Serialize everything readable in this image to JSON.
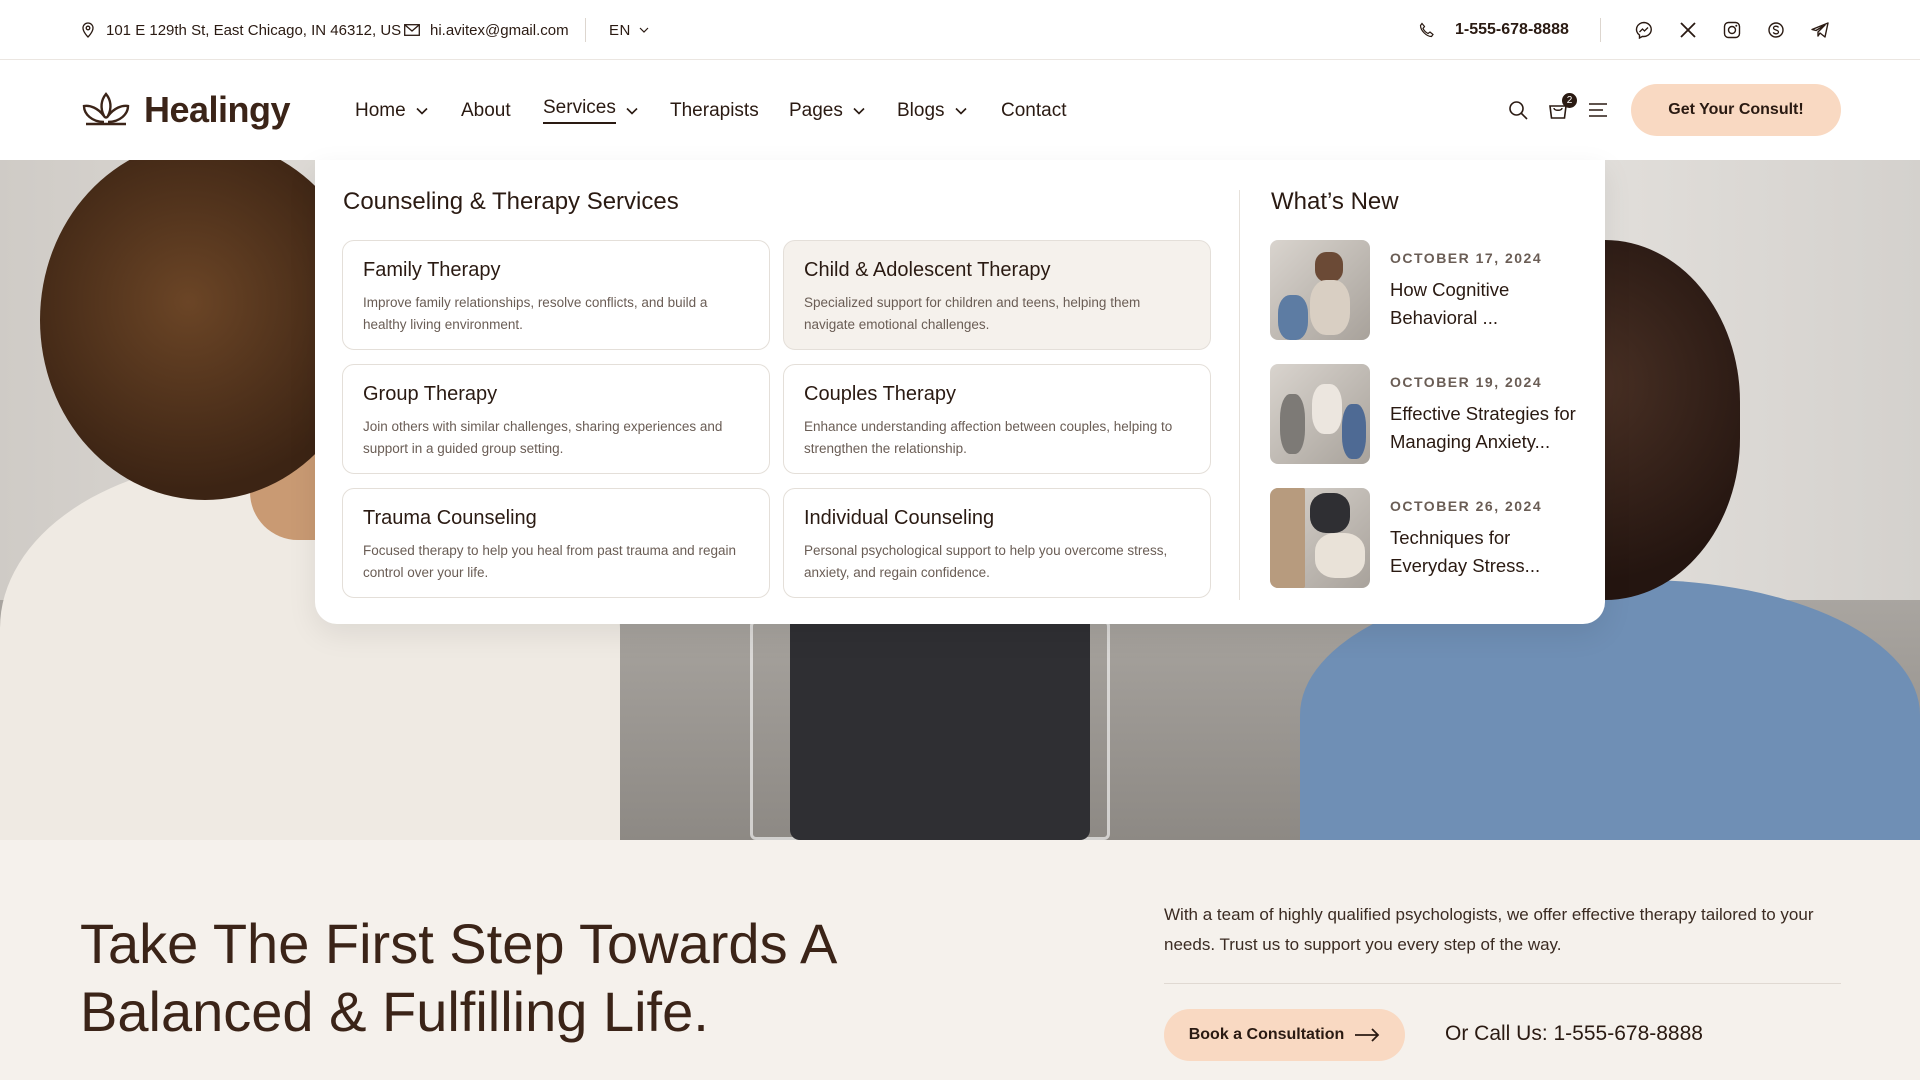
{
  "topbar": {
    "address": "101 E 129th St, East Chicago, IN 46312, US",
    "email": "hi.avitex@gmail.com",
    "language": "EN",
    "phone": "1-555-678-8888",
    "socials": [
      "messenger-icon",
      "x-icon",
      "instagram-icon",
      "skype-icon",
      "telegram-icon"
    ]
  },
  "header": {
    "logo": "Healingy",
    "nav": [
      {
        "label": "Home",
        "dropdown": true
      },
      {
        "label": "About",
        "dropdown": false
      },
      {
        "label": "Services",
        "dropdown": true,
        "active": true
      },
      {
        "label": "Therapists",
        "dropdown": false
      },
      {
        "label": "Pages",
        "dropdown": true
      },
      {
        "label": "Blogs",
        "dropdown": true
      },
      {
        "label": "Contact",
        "dropdown": false
      }
    ],
    "cart_count": "2",
    "cta": "Get Your Consult!"
  },
  "mega": {
    "services_title": "Counseling & Therapy Services",
    "services": [
      {
        "title": "Family Therapy",
        "desc": "Improve family relationships, resolve conflicts, and build a healthy living environment."
      },
      {
        "title": "Child & Adolescent Therapy",
        "desc": "Specialized support for children and teens, helping them navigate emotional challenges."
      },
      {
        "title": "Group Therapy",
        "desc": "Join others with similar challenges, sharing experiences and support in a guided group setting."
      },
      {
        "title": "Couples Therapy",
        "desc": "Enhance understanding affection between couples, helping to strengthen the relationship."
      },
      {
        "title": "Trauma Counseling",
        "desc": "Focused therapy to help you heal from past trauma and regain control over your life."
      },
      {
        "title": "Individual Counseling",
        "desc": "Personal psychological support to help you overcome stress, anxiety, and regain confidence."
      }
    ],
    "news_title": "What’s New",
    "news": [
      {
        "date": "OCTOBER 17, 2024",
        "title": "How Cognitive Behavioral ..."
      },
      {
        "date": "OCTOBER 19, 2024",
        "title": "Effective Strategies for Managing Anxiety..."
      },
      {
        "date": "OCTOBER 26, 2024",
        "title": "Techniques for Everyday Stress..."
      }
    ]
  },
  "bottom": {
    "headline": "Take The First Step Towards A Balanced & Fulfilling Life.",
    "description": "With a team of highly qualified psychologists, we offer effective therapy tailored to your needs. Trust us to support you every step of the way.",
    "book_button": "Book a Consultation",
    "call_text": "Or Call Us: 1-555-678-8888"
  },
  "colors": {
    "accent": "#f9d9c2",
    "text": "#2a1a12",
    "cream": "#f5f1ec"
  }
}
